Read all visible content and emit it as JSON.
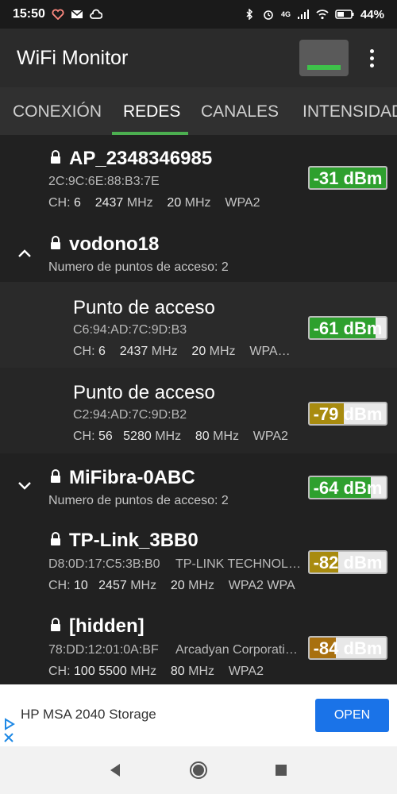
{
  "status_bar": {
    "time": "15:50",
    "battery": "44%",
    "network": "4G",
    "left_icons": [
      "heart-icon",
      "mail-icon",
      "cloud-icon"
    ],
    "right_icons": [
      "bluetooth-icon",
      "alarm-icon",
      "cell-signal-icon",
      "wifi-icon",
      "battery-icon"
    ]
  },
  "app_bar": {
    "title": "WiFi Monitor",
    "signal_button_color": "#3ec24a"
  },
  "tabs": [
    {
      "label": "CONEXIÓN",
      "active": false
    },
    {
      "label": "REDES",
      "active": true
    },
    {
      "label": "CANALES",
      "active": false
    },
    {
      "label": "INTENSIDAD",
      "active": false
    }
  ],
  "accent_color": "#4caf50",
  "networks": [
    {
      "ssid": "AP_2348346985",
      "mac": "2C:9C:6E:88:B3:7E",
      "ch_label": "CH:",
      "ch": "6",
      "freq": "2437",
      "freq_unit": "MHz",
      "width": "20",
      "width_unit": "MHz",
      "security": "WPA2",
      "dbm": "-31 dBm",
      "dbm_level": 1.0,
      "dbm_color": "#2ea02e"
    },
    {
      "ssid": "vodono18",
      "count_label": "Numero de puntos de acceso: 2",
      "expanded": true,
      "access_points": [
        {
          "title": "Punto de acceso",
          "mac": "C6:94:AD:7C:9D:B3",
          "ch_label": "CH:",
          "ch": "6",
          "freq": "2437",
          "freq_unit": "MHz",
          "width": "20",
          "width_unit": "MHz",
          "security": "WPA…",
          "dbm": "-61 dBm",
          "dbm_level": 0.86,
          "dbm_color": "#2ea02e"
        },
        {
          "title": "Punto de acceso",
          "mac": "C2:94:AD:7C:9D:B2",
          "ch_label": "CH:",
          "ch": "56",
          "freq": "5280",
          "freq_unit": "MHz",
          "width": "80",
          "width_unit": "MHz",
          "security": "WPA2",
          "dbm": "-79 dBm",
          "dbm_level": 0.45,
          "dbm_color": "#a88b0f"
        }
      ]
    },
    {
      "ssid": "MiFibra-0ABC",
      "count_label": "Numero de puntos de acceso: 2",
      "expanded": false,
      "dbm": "-64 dBm",
      "dbm_level": 0.8,
      "dbm_color": "#2ea02e"
    },
    {
      "ssid": "TP-Link_3BB0",
      "mac": "D8:0D:17:C5:3B:B0",
      "vendor": "TP-LINK TECHNOL…",
      "ch_label": "CH:",
      "ch": "10",
      "freq": "2457",
      "freq_unit": "MHz",
      "width": "20",
      "width_unit": "MHz",
      "security": "WPA2 WPA",
      "dbm": "-82 dBm",
      "dbm_level": 0.38,
      "dbm_color": "#a88b0f"
    },
    {
      "ssid": "[hidden]",
      "mac": "78:DD:12:01:0A:BF",
      "vendor": "Arcadyan Corporati…",
      "ch_label": "CH:",
      "ch": "100",
      "freq": "5500",
      "freq_unit": "MHz",
      "width": "80",
      "width_unit": "MHz",
      "security": "WPA2",
      "dbm": "-84 dBm",
      "dbm_level": 0.34,
      "dbm_color": "#a8700f"
    }
  ],
  "ad": {
    "text": "HP MSA 2040 Storage",
    "button": "OPEN",
    "button_color": "#1a73e8"
  },
  "nav_bar": {
    "icons": [
      "back-icon",
      "home-icon",
      "recents-icon"
    ]
  }
}
